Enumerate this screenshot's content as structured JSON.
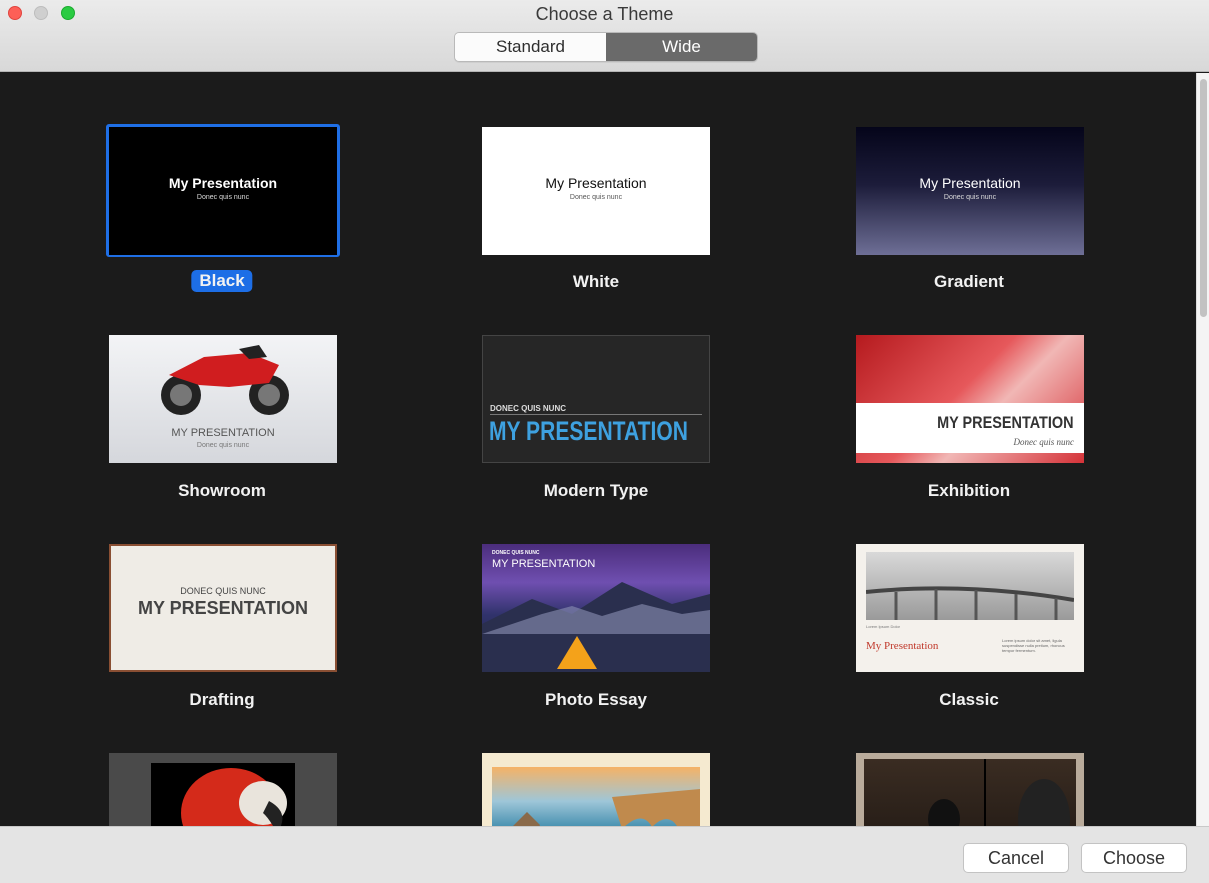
{
  "window": {
    "title": "Choose a Theme",
    "segments": [
      {
        "label": "Standard",
        "active": false
      },
      {
        "label": "Wide",
        "active": true
      }
    ]
  },
  "sample": {
    "title": "My Presentation",
    "subtitle": "Donec quis nunc",
    "title_caps": "MY PRESENTATION",
    "subtitle_caps": "DONEC QUIS NUNC",
    "classic_caption": "Lorem Ipsum Dolor",
    "classic_body": "Lorem ipsum dolor sit amet, ligula suspendisse nulla pretium, rhoncus tempor fermentum."
  },
  "themes": [
    {
      "name": "Black",
      "selected": true
    },
    {
      "name": "White",
      "selected": false
    },
    {
      "name": "Gradient",
      "selected": false
    },
    {
      "name": "Showroom",
      "selected": false
    },
    {
      "name": "Modern Type",
      "selected": false
    },
    {
      "name": "Exhibition",
      "selected": false
    },
    {
      "name": "Drafting",
      "selected": false
    },
    {
      "name": "Photo Essay",
      "selected": false
    },
    {
      "name": "Classic",
      "selected": false
    },
    {
      "name": "",
      "selected": false
    },
    {
      "name": "",
      "selected": false
    },
    {
      "name": "",
      "selected": false
    }
  ],
  "footer": {
    "cancel_label": "Cancel",
    "choose_label": "Choose"
  },
  "colors": {
    "selection": "#1d6ee6",
    "modern_type_accent": "#3ea1e0",
    "classic_accent": "#c0392b"
  }
}
